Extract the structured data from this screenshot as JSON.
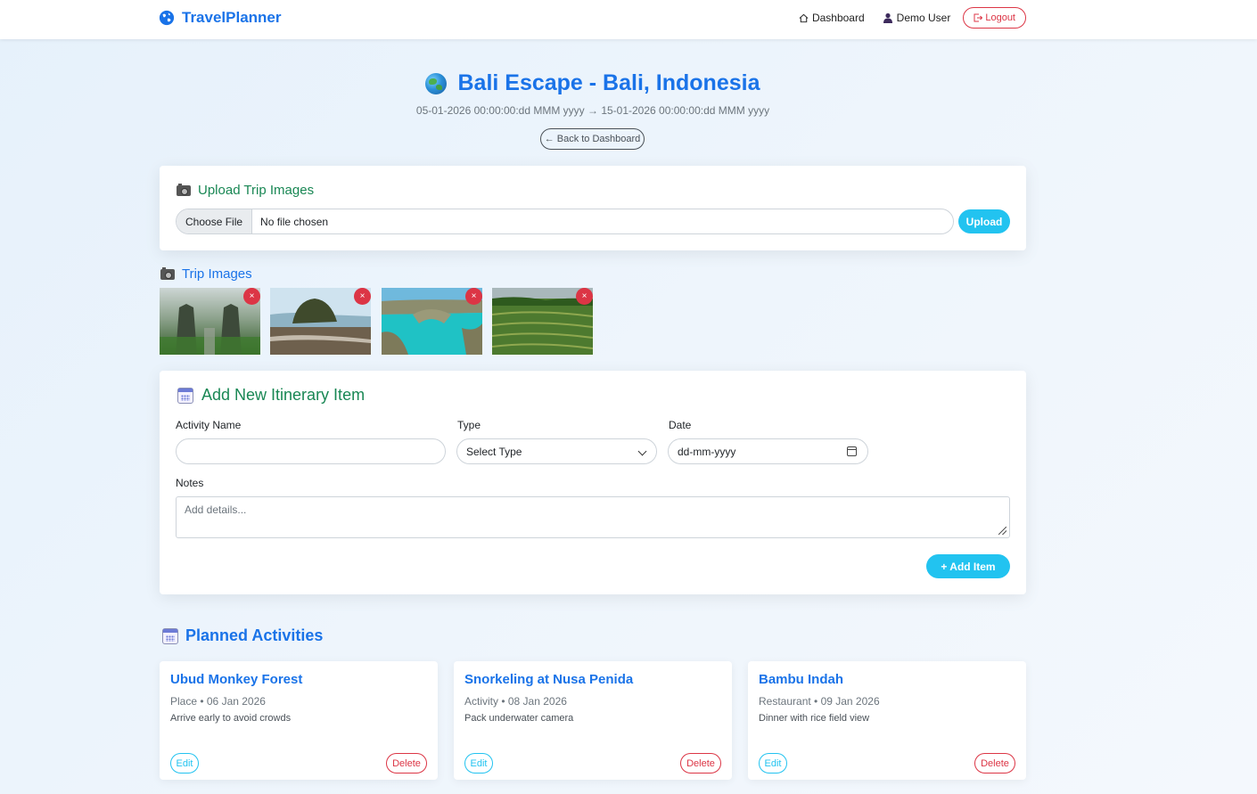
{
  "navbar": {
    "brand": "TravelPlanner",
    "dashboard_label": "Dashboard",
    "user_label": "Demo User",
    "logout_label": "Logout"
  },
  "trip": {
    "title": "Bali Escape - Bali, Indonesia",
    "date_range": "05-01-2026 00:00:00:dd MMM yyyy → 15-01-2026 00:00:00:dd MMM yyyy",
    "back_label": "← Back to Dashboard"
  },
  "upload": {
    "heading": "Upload Trip Images",
    "choose_file_label": "Choose File",
    "file_status": "No file chosen",
    "upload_label": "Upload"
  },
  "trip_images": {
    "heading": "Trip Images",
    "remove_label": "×",
    "images": [
      {
        "alt": "temple gate in mist"
      },
      {
        "alt": "coastal rock temple"
      },
      {
        "alt": "turquoise cove"
      },
      {
        "alt": "rice terraces"
      }
    ]
  },
  "itinerary_form": {
    "heading": "Add New Itinerary Item",
    "activity_name_label": "Activity Name",
    "activity_name_value": "",
    "type_label": "Type",
    "type_selected": "Select Type",
    "date_label": "Date",
    "date_placeholder": "dd-mm-yyyy",
    "notes_label": "Notes",
    "notes_placeholder": "Add details...",
    "add_label": "+ Add Item"
  },
  "planned": {
    "heading": "Planned Activities",
    "edit_label": "Edit",
    "delete_label": "Delete",
    "items": [
      {
        "name": "Ubud Monkey Forest",
        "meta": "Place • 06 Jan 2026",
        "notes": "Arrive early to avoid crowds"
      },
      {
        "name": "Snorkeling at Nusa Penida",
        "meta": "Activity • 08 Jan 2026",
        "notes": "Pack underwater camera"
      },
      {
        "name": "Bambu Indah",
        "meta": "Restaurant • 09 Jan 2026",
        "notes": "Dinner with rice field view"
      }
    ]
  },
  "colors": {
    "primary": "#1a73e8",
    "success": "#198754",
    "info": "#22c3f0",
    "danger": "#dc3545"
  }
}
